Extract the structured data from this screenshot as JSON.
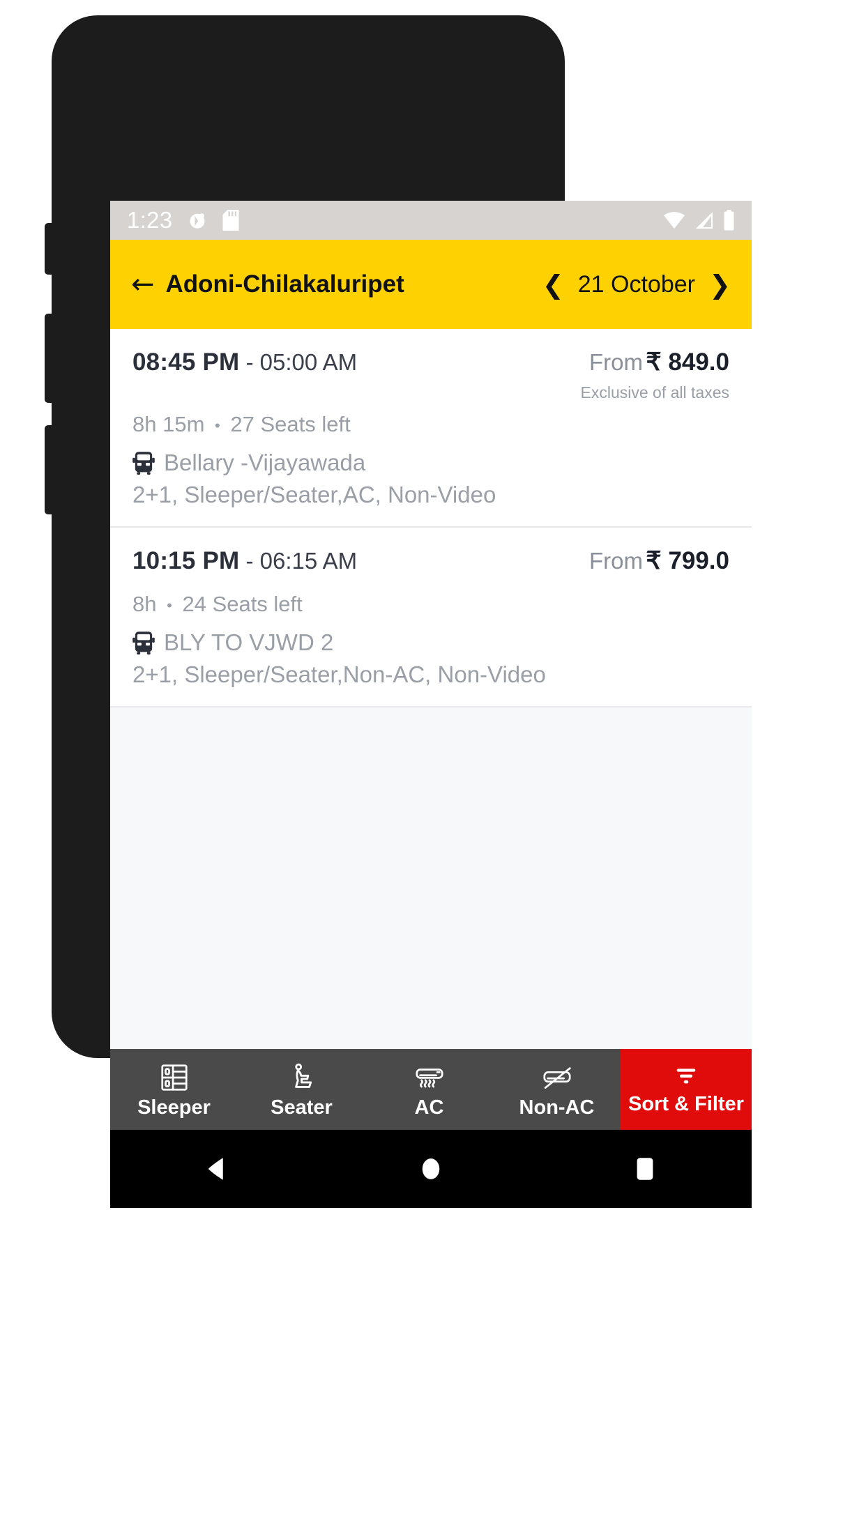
{
  "status_bar": {
    "time": "1:23",
    "left_icons": [
      "contacts-sync-icon",
      "sd-card-icon"
    ],
    "right_icons": [
      "wifi-icon",
      "cellular-signal-icon",
      "battery-icon"
    ],
    "background_color": "#d6d3d0",
    "icon_color": "#ffffff"
  },
  "app_bar": {
    "back_icon": "back-arrow-icon",
    "route_title": "Adoni-Chilakaluripet",
    "prev_icon": "chevron-left-icon",
    "date": "21 October",
    "next_icon": "chevron-right-icon",
    "background_color": "#fdd102"
  },
  "buses": [
    {
      "departure_time": "08:45 PM",
      "separator": " - ",
      "arrival_time": "05:00 AM",
      "duration": "8h 15m",
      "bullet": "•",
      "seats_left": "27 Seats left",
      "bus_icon": "bus-icon",
      "operator": "Bellary -Vijayawada",
      "amenities": "2+1, Sleeper/Seater,AC, Non-Video",
      "price_prefix": "From",
      "price": "₹ 849.0",
      "tax_note": "Exclusive of all taxes"
    },
    {
      "departure_time": "10:15 PM",
      "separator": " - ",
      "arrival_time": "06:15 AM",
      "duration": "8h",
      "bullet": "•",
      "seats_left": "24 Seats left",
      "bus_icon": "bus-icon",
      "operator": "BLY TO VJWD 2",
      "amenities": "2+1, Sleeper/Seater,Non-AC, Non-Video",
      "price_prefix": "From",
      "price": "₹ 799.0",
      "tax_note": ""
    }
  ],
  "filter_bar": {
    "background_color": "#4a4a4a",
    "items": [
      {
        "label": "Sleeper",
        "icon": "sleeper-berth-icon"
      },
      {
        "label": "Seater",
        "icon": "seat-icon"
      },
      {
        "label": "AC",
        "icon": "air-conditioner-icon"
      },
      {
        "label": "Non-AC",
        "icon": "air-conditioner-off-icon"
      }
    ],
    "sort_filter": {
      "label": "Sort & Filter",
      "icon": "filter-funnel-icon",
      "background_color": "#e00b0b"
    }
  },
  "nav_bar": {
    "back": "nav-back-icon",
    "home": "nav-home-icon",
    "recents": "nav-recents-icon",
    "background_color": "#000000"
  }
}
